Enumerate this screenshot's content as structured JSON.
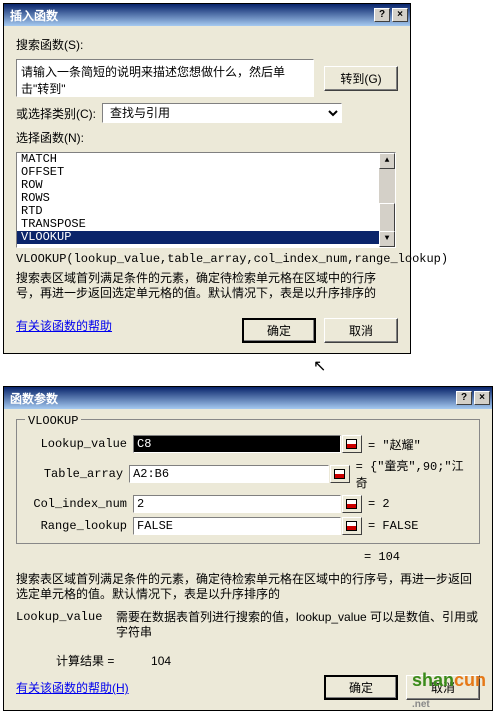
{
  "dialog1": {
    "title": "插入函数",
    "help_btn": "?",
    "close_btn": "×",
    "search_label": "搜索函数(S):",
    "search_text": "请输入一条简短的说明来描述您想做什么，然后单击\"转到\"",
    "go_btn": "转到(G)",
    "category_label": "或选择类别(C):",
    "category_value": "查找与引用",
    "select_label": "选择函数(N):",
    "functions": [
      "MATCH",
      "OFFSET",
      "ROW",
      "ROWS",
      "RTD",
      "TRANSPOSE",
      "VLOOKUP"
    ],
    "signature": "VLOOKUP(lookup_value,table_array,col_index_num,range_lookup)",
    "description": "搜索表区域首列满足条件的元素，确定待检索单元格在区域中的行序号，再进一步返回选定单元格的值。默认情况下，表是以升序排序的",
    "help_link": "有关该函数的帮助",
    "ok_btn": "确定",
    "cancel_btn": "取消"
  },
  "dialog2": {
    "title": "函数参数",
    "help_btn": "?",
    "close_btn": "×",
    "func_name": "VLOOKUP",
    "params": [
      {
        "label": "Lookup_value",
        "value": "C8",
        "result": "= \"赵耀\""
      },
      {
        "label": "Table_array",
        "value": "A2:B6",
        "result": "= {\"童亮\",90;\"江奇"
      },
      {
        "label": "Col_index_num",
        "value": "2",
        "result": "= 2"
      },
      {
        "label": "Range_lookup",
        "value": "FALSE",
        "result": "= FALSE"
      }
    ],
    "equals_result": "= 104",
    "description": "搜索表区域首列满足条件的元素，确定待检索单元格在区域中的行序号，再进一步返回选定单元格的值。默认情况下，表是以升序排序的",
    "param_help_label": "Lookup_value",
    "param_help_text": "需要在数据表首列进行搜索的值，lookup_value 可以是数值、引用或字符串",
    "calc_label": "计算结果 =",
    "calc_value": "104",
    "help_link": "有关该函数的帮助(H)",
    "ok_btn": "确定",
    "cancel_btn": "取消"
  },
  "watermark": {
    "text": "shancun",
    ".net": ".net"
  }
}
